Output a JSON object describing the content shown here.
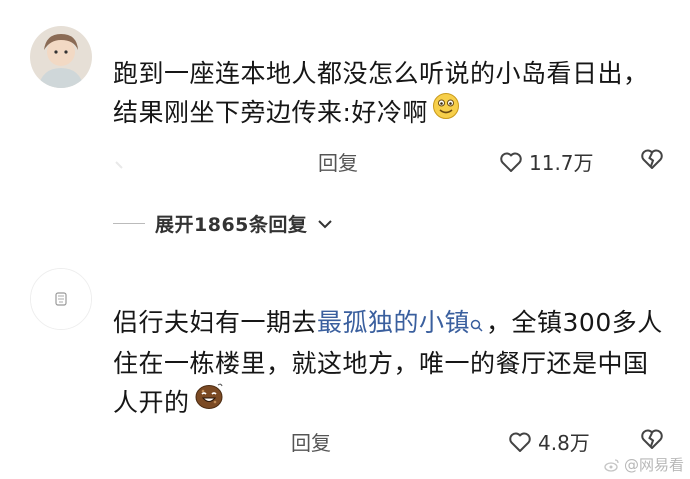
{
  "comments": [
    {
      "text": "跑到一座连本地人都没怎么听说的小岛看日出，结果刚坐下旁边传来:好冷啊",
      "reply_label": "回复",
      "likes": "11.7万",
      "avatar_icon": "user-photo-avatar",
      "emoji_icon": "cold-face-emoji"
    },
    {
      "text_before": "侣行夫妇有一期去",
      "link_text": "最孤独的小镇",
      "text_after": "，全镇300多人住在一栋楼里，就这地方，唯一的餐厅还是中国人开的",
      "reply_label": "回复",
      "likes": "4.8万",
      "avatar_icon": "sketch-avatar",
      "emoji_icon": "laughing-cookie-emoji"
    }
  ],
  "expand_replies": "展开1865条回复",
  "watermark": "@网易看"
}
